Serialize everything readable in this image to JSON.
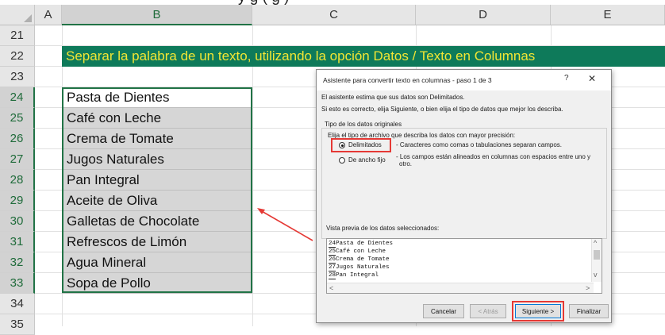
{
  "top_partial_text": "y g ( g )",
  "columns": [
    "A",
    "B",
    "C",
    "D",
    "E"
  ],
  "rows": [
    "21",
    "22",
    "23",
    "24",
    "25",
    "26",
    "27",
    "28",
    "29",
    "30",
    "31",
    "32",
    "33",
    "34",
    "35"
  ],
  "banner": {
    "text": "Separar la palabra de un texto, utilizando la opción Datos / Texto en Columnas"
  },
  "items": [
    "Pasta de Dientes",
    "Café con Leche",
    "Crema de Tomate",
    "Jugos Naturales",
    "Pan Integral",
    "Aceite de Oliva",
    "Galletas de Chocolate",
    "Refrescos de Limón",
    "Agua Mineral",
    "Sopa de Pollo"
  ],
  "dialog": {
    "title": "Asistente para convertir texto en columnas - paso 1 de 3",
    "help": "?",
    "close": "✕",
    "line1": "El asistente estima que sus datos son Delimitados.",
    "line2": "Si esto es correcto, elija Siguiente, o bien elija el tipo de datos que mejor los describa.",
    "group_title": "Tipo de los datos originales",
    "group_instruction": "Elija el tipo de archivo que describa los datos con mayor precisión:",
    "option_delimited": {
      "label": "Delimitados",
      "desc": "- Caracteres como comas o tabulaciones separan campos.",
      "selected": true
    },
    "option_fixed": {
      "label": "De ancho fijo",
      "desc_line1": "- Los campos están alineados en columnas con espacios entre uno y",
      "desc_line2": "otro.",
      "selected": false
    },
    "preview_label": "Vista previa de los datos seleccionados:",
    "preview_rows": [
      {
        "n": "24",
        "text": "Pasta de Dientes"
      },
      {
        "n": "25",
        "text": "Café con Leche"
      },
      {
        "n": "26",
        "text": "Crema de Tomate"
      },
      {
        "n": "27",
        "text": "Jugos Naturales"
      },
      {
        "n": "28",
        "text": "Pan Integral"
      }
    ],
    "buttons": {
      "cancel": "Cancelar",
      "back": "< Atrás",
      "next": "Siguiente >",
      "finish": "Finalizar"
    }
  },
  "colors": {
    "banner_bg": "#0e7a5a",
    "banner_text": "#f2e634",
    "highlight": "#e53935",
    "selection": "#217346",
    "cell_gray": "#d6d6d6"
  }
}
